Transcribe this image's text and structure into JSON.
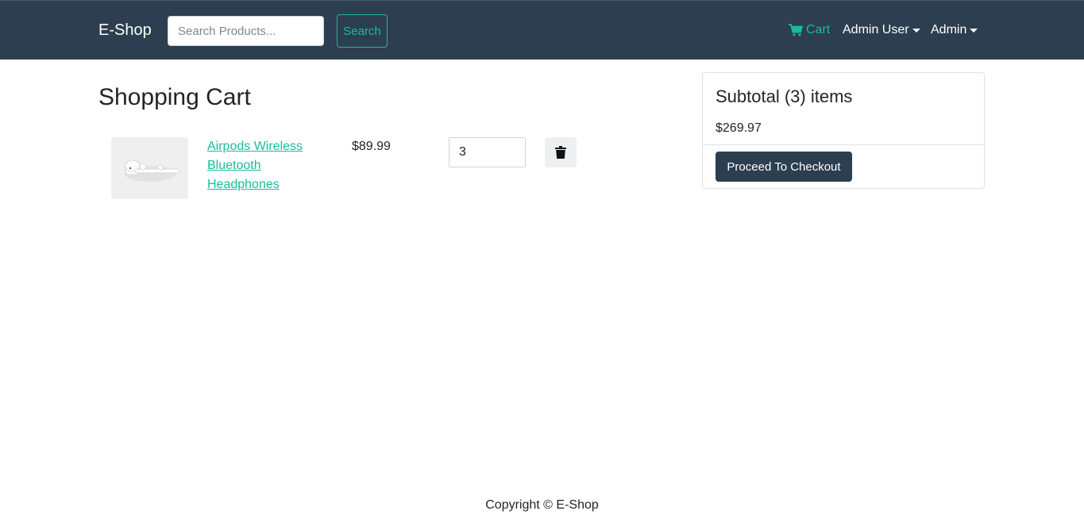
{
  "navbar": {
    "brand": "E-Shop",
    "search_placeholder": "Search Products...",
    "search_button": "Search",
    "cart_label": "Cart",
    "user_menu": "Admin User",
    "admin_menu": "Admin"
  },
  "cart": {
    "title": "Shopping Cart",
    "items": [
      {
        "name": "Airpods Wireless Bluetooth Headphones",
        "price": "$89.99",
        "quantity": "3"
      }
    ]
  },
  "summary": {
    "title": "Subtotal (3) items",
    "total": "$269.97",
    "checkout_button": "Proceed To Checkout"
  },
  "footer": {
    "copyright": "Copyright © E-Shop"
  },
  "colors": {
    "navbar_bg": "#2c3e50",
    "accent": "#18bc9c"
  }
}
